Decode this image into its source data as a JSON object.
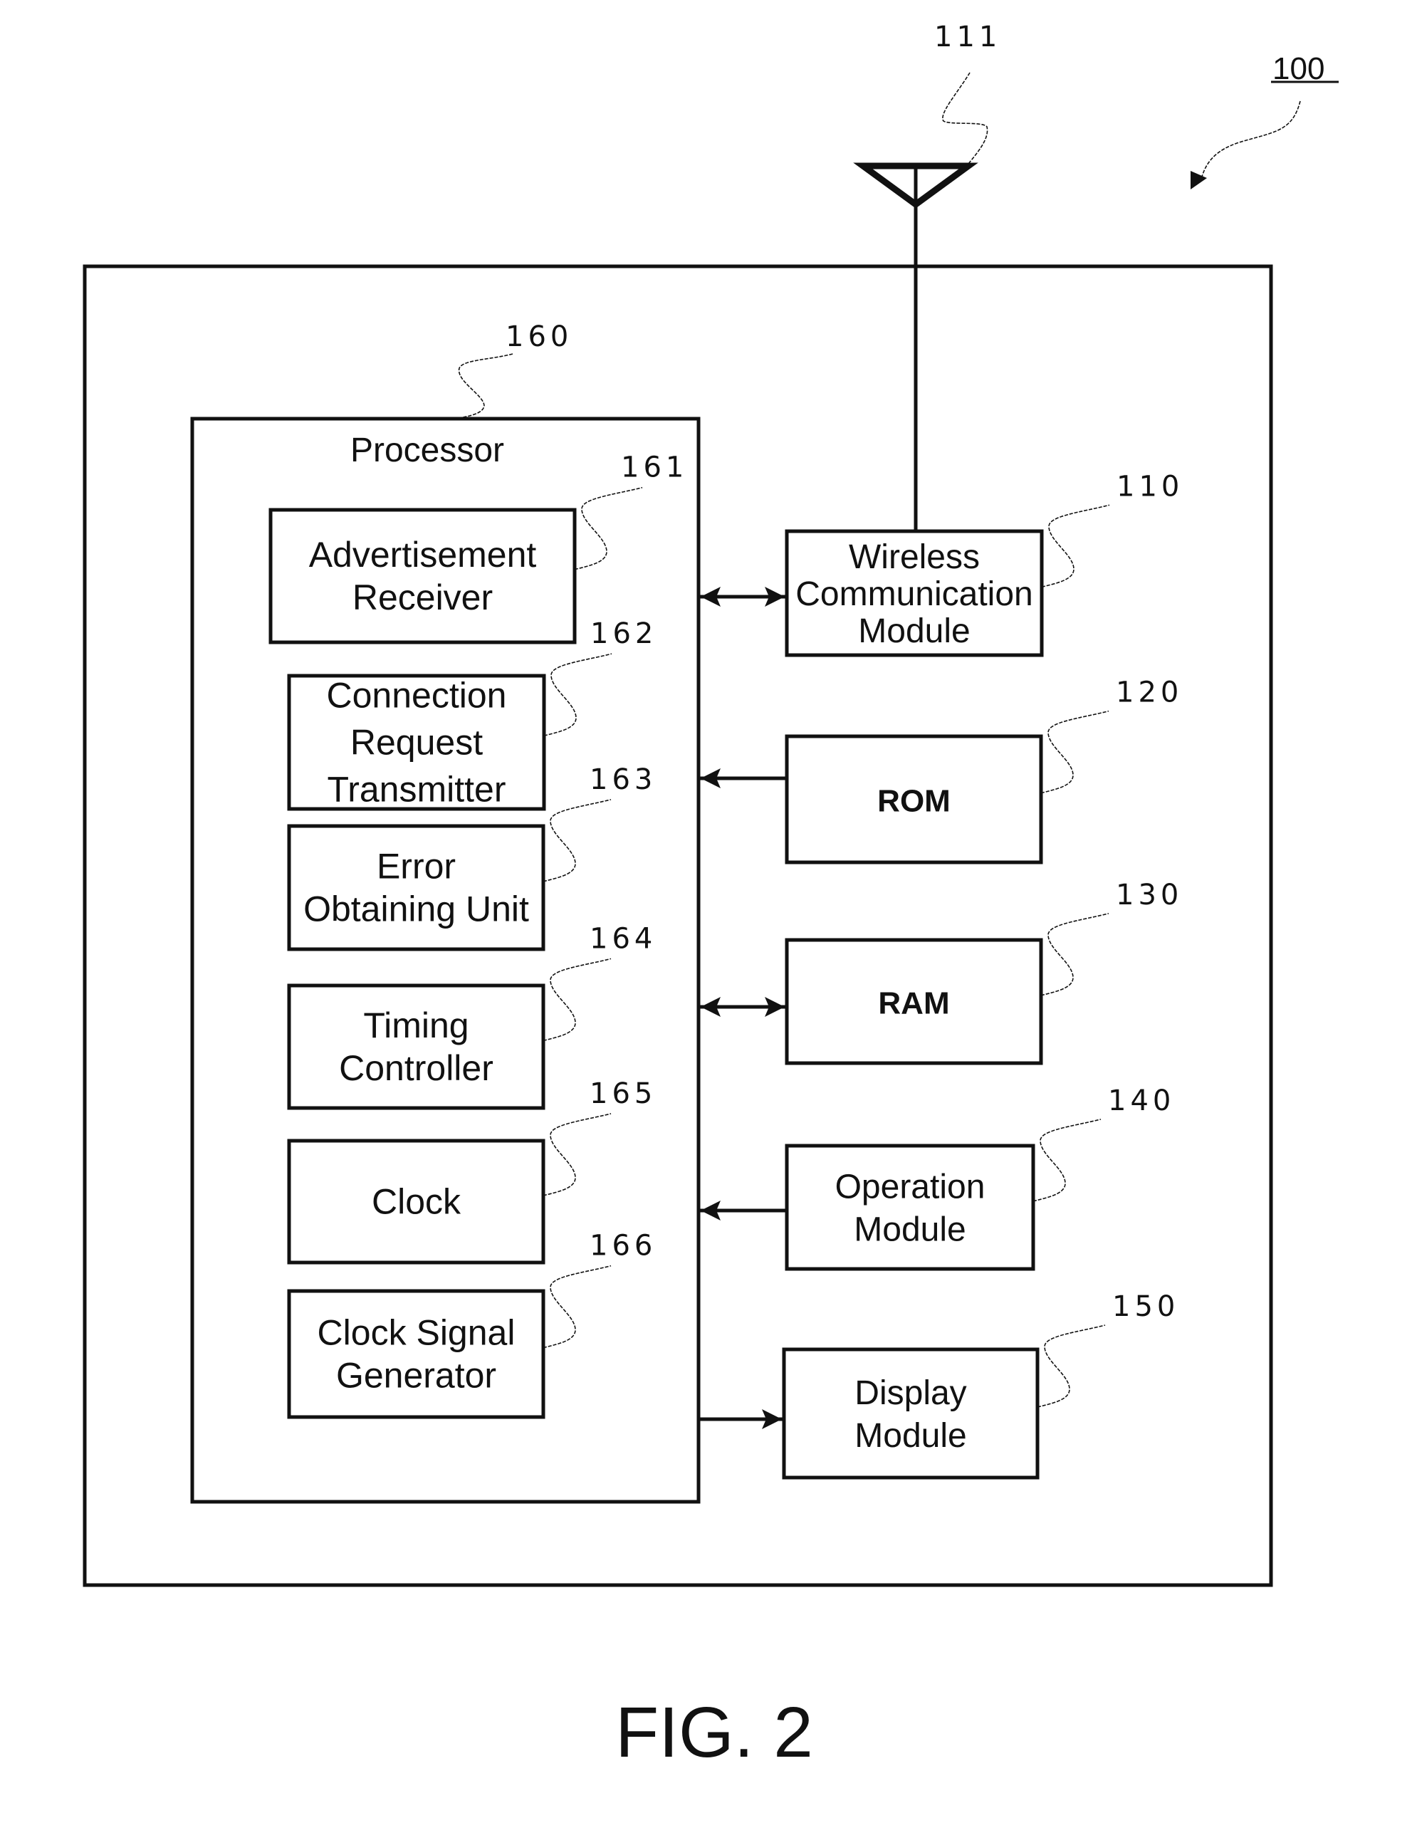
{
  "figure": {
    "caption": "FIG. 2",
    "device_ref": "100",
    "antenna_ref": "111"
  },
  "processor": {
    "ref": "160",
    "title": "Processor",
    "units": [
      {
        "ref": "161",
        "lines": [
          "Advertisement",
          "Receiver"
        ]
      },
      {
        "ref": "162",
        "lines": [
          "Connection",
          "Request",
          "Transmitter"
        ]
      },
      {
        "ref": "163",
        "lines": [
          "Error",
          "Obtaining Unit"
        ]
      },
      {
        "ref": "164",
        "lines": [
          "Timing",
          "Controller"
        ]
      },
      {
        "ref": "165",
        "lines": [
          "Clock"
        ]
      },
      {
        "ref": "166",
        "lines": [
          "Clock Signal",
          "Generator"
        ]
      }
    ]
  },
  "modules": [
    {
      "ref": "110",
      "lines": [
        "Wireless",
        "Communication",
        "Module"
      ],
      "link": "bidirectional"
    },
    {
      "ref": "120",
      "lines": [
        "ROM"
      ],
      "link": "to-processor"
    },
    {
      "ref": "130",
      "lines": [
        "RAM"
      ],
      "link": "bidirectional"
    },
    {
      "ref": "140",
      "lines": [
        "Operation",
        "Module"
      ],
      "link": "to-processor"
    },
    {
      "ref": "150",
      "lines": [
        "Display",
        "Module"
      ],
      "link": "from-processor"
    }
  ]
}
